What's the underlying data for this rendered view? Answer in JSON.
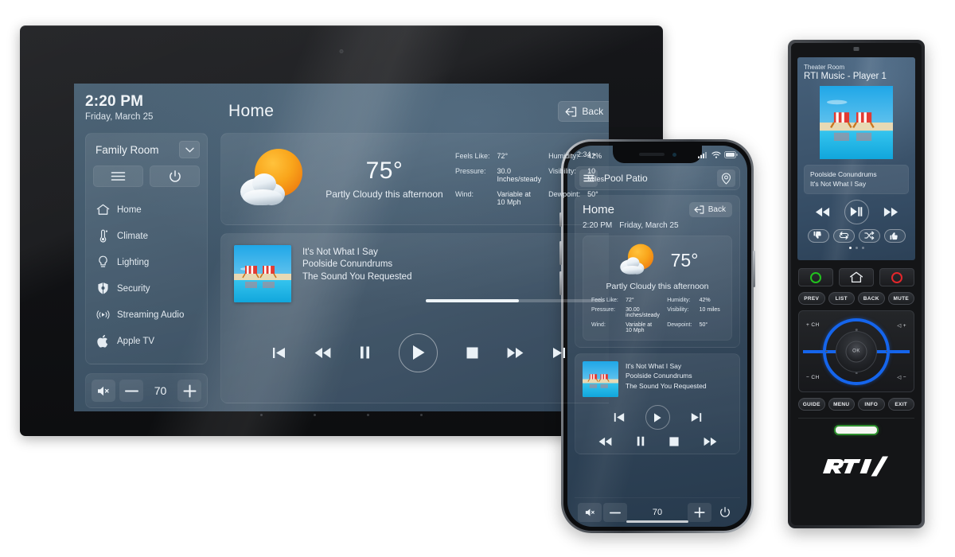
{
  "tablet": {
    "clock": {
      "time": "2:20 PM",
      "date": "Friday, March 25"
    },
    "room": {
      "name": "Family Room",
      "chevron_icon": "chevron-down-icon",
      "menu_icon": "hamburger-menu-icon",
      "power_icon": "power-icon"
    },
    "nav": [
      {
        "label": "Home",
        "icon": "house-icon"
      },
      {
        "label": "Climate",
        "icon": "thermometer-icon"
      },
      {
        "label": "Lighting",
        "icon": "lightbulb-icon"
      },
      {
        "label": "Security",
        "icon": "shield-icon"
      },
      {
        "label": "Streaming Audio",
        "icon": "broadcast-icon"
      },
      {
        "label": "Apple TV",
        "icon": "apple-icon"
      }
    ],
    "volume": {
      "mute_icon": "speaker-mute-icon",
      "minus": "−",
      "value": "70",
      "plus": "+"
    },
    "header": {
      "title": "Home",
      "back_label": "Back",
      "back_icon": "back-arrow-icon"
    },
    "weather": {
      "icon": "partly-cloudy-icon",
      "temperature": "75°",
      "condition": "Partly Cloudy this afternoon",
      "details": [
        {
          "key": "Feels Like:",
          "value": "72°"
        },
        {
          "key": "Humidity:",
          "value": "42%"
        },
        {
          "key": "Pressure:",
          "value": "30.0\nInches/steady"
        },
        {
          "key": "Visibility:",
          "value": "10 Miles"
        },
        {
          "key": "Wind:",
          "value": "Variable at\n10 Mph"
        },
        {
          "key": "Dewpoint:",
          "value": "50°"
        }
      ]
    },
    "media": {
      "track": "It's Not What I Say",
      "artist": "Poolside Conundrums",
      "album": "The Sound You Requested",
      "progress_percent": 52,
      "controls": [
        "skip-back-icon",
        "rewind-icon",
        "pause-icon",
        "play-icon",
        "stop-icon",
        "fast-forward-icon",
        "skip-forward-icon"
      ]
    }
  },
  "phone": {
    "status": {
      "time": "2:34",
      "location_arrow": "▸",
      "signal_icon": "cellular-signal-icon",
      "wifi_icon": "wifi-icon",
      "battery_icon": "battery-icon"
    },
    "topbar": {
      "menu_icon": "hamburger-menu-icon",
      "room": "Pool Patio",
      "location_icon": "location-pin-icon"
    },
    "header": {
      "title": "Home",
      "back_label": "Back",
      "back_icon": "back-arrow-icon",
      "time": "2:20 PM",
      "date": "Friday, March 25"
    },
    "weather": {
      "icon": "partly-cloudy-icon",
      "temperature": "75°",
      "condition": "Partly Cloudy this afternoon",
      "details": [
        {
          "key": "Feels Like:",
          "value": "72°"
        },
        {
          "key": "Humidity:",
          "value": "42%"
        },
        {
          "key": "Pressure:",
          "value": "30.00\ninches/steady"
        },
        {
          "key": "Visibility:",
          "value": "10 miles"
        },
        {
          "key": "Wind:",
          "value": "Variable at\n10 Mph"
        },
        {
          "key": "Dewpoint:",
          "value": "50°"
        }
      ]
    },
    "media": {
      "track": "It's Not What I Say",
      "artist": "Poolside Conundrums",
      "album": "The Sound You Requested",
      "row1": [
        "skip-back-icon",
        "play-icon",
        "skip-forward-icon"
      ],
      "row2": [
        "rewind-icon",
        "pause-icon",
        "stop-icon",
        "fast-forward-icon"
      ]
    },
    "volume": {
      "mute_icon": "speaker-mute-icon",
      "minus": "−",
      "value": "70",
      "plus": "+",
      "power_icon": "power-icon"
    }
  },
  "remote": {
    "screen": {
      "room": "Theater Room",
      "source": "RTI Music - Player 1",
      "album_art": "poolside-chairs-art",
      "now_playing_title": "Poolside Conundrums",
      "now_playing_sub": "It's Not What I Say",
      "transport": [
        "rewind-icon",
        "play-pause-icon",
        "fast-forward-icon"
      ],
      "pills": [
        "thumbs-down-icon",
        "repeat-icon",
        "shuffle-icon",
        "thumbs-up-icon"
      ],
      "page_dots": 3,
      "active_dot": 0
    },
    "hard_buttons": {
      "top_row": [
        {
          "name": "power-on-button",
          "icon": "green-ring-icon"
        },
        {
          "name": "home-button",
          "icon": "house-icon"
        },
        {
          "name": "power-off-button",
          "icon": "red-ring-icon"
        }
      ],
      "row1": [
        "PREV",
        "LIST",
        "BACK",
        "MUTE"
      ],
      "dpad": {
        "up": "+ CH",
        "down": "− CH",
        "right": "◁ +",
        "left": "◁ −",
        "center": "OK"
      },
      "row2": [
        "GUIDE",
        "MENU",
        "INFO",
        "EXIT"
      ]
    },
    "brand": "RTI"
  }
}
